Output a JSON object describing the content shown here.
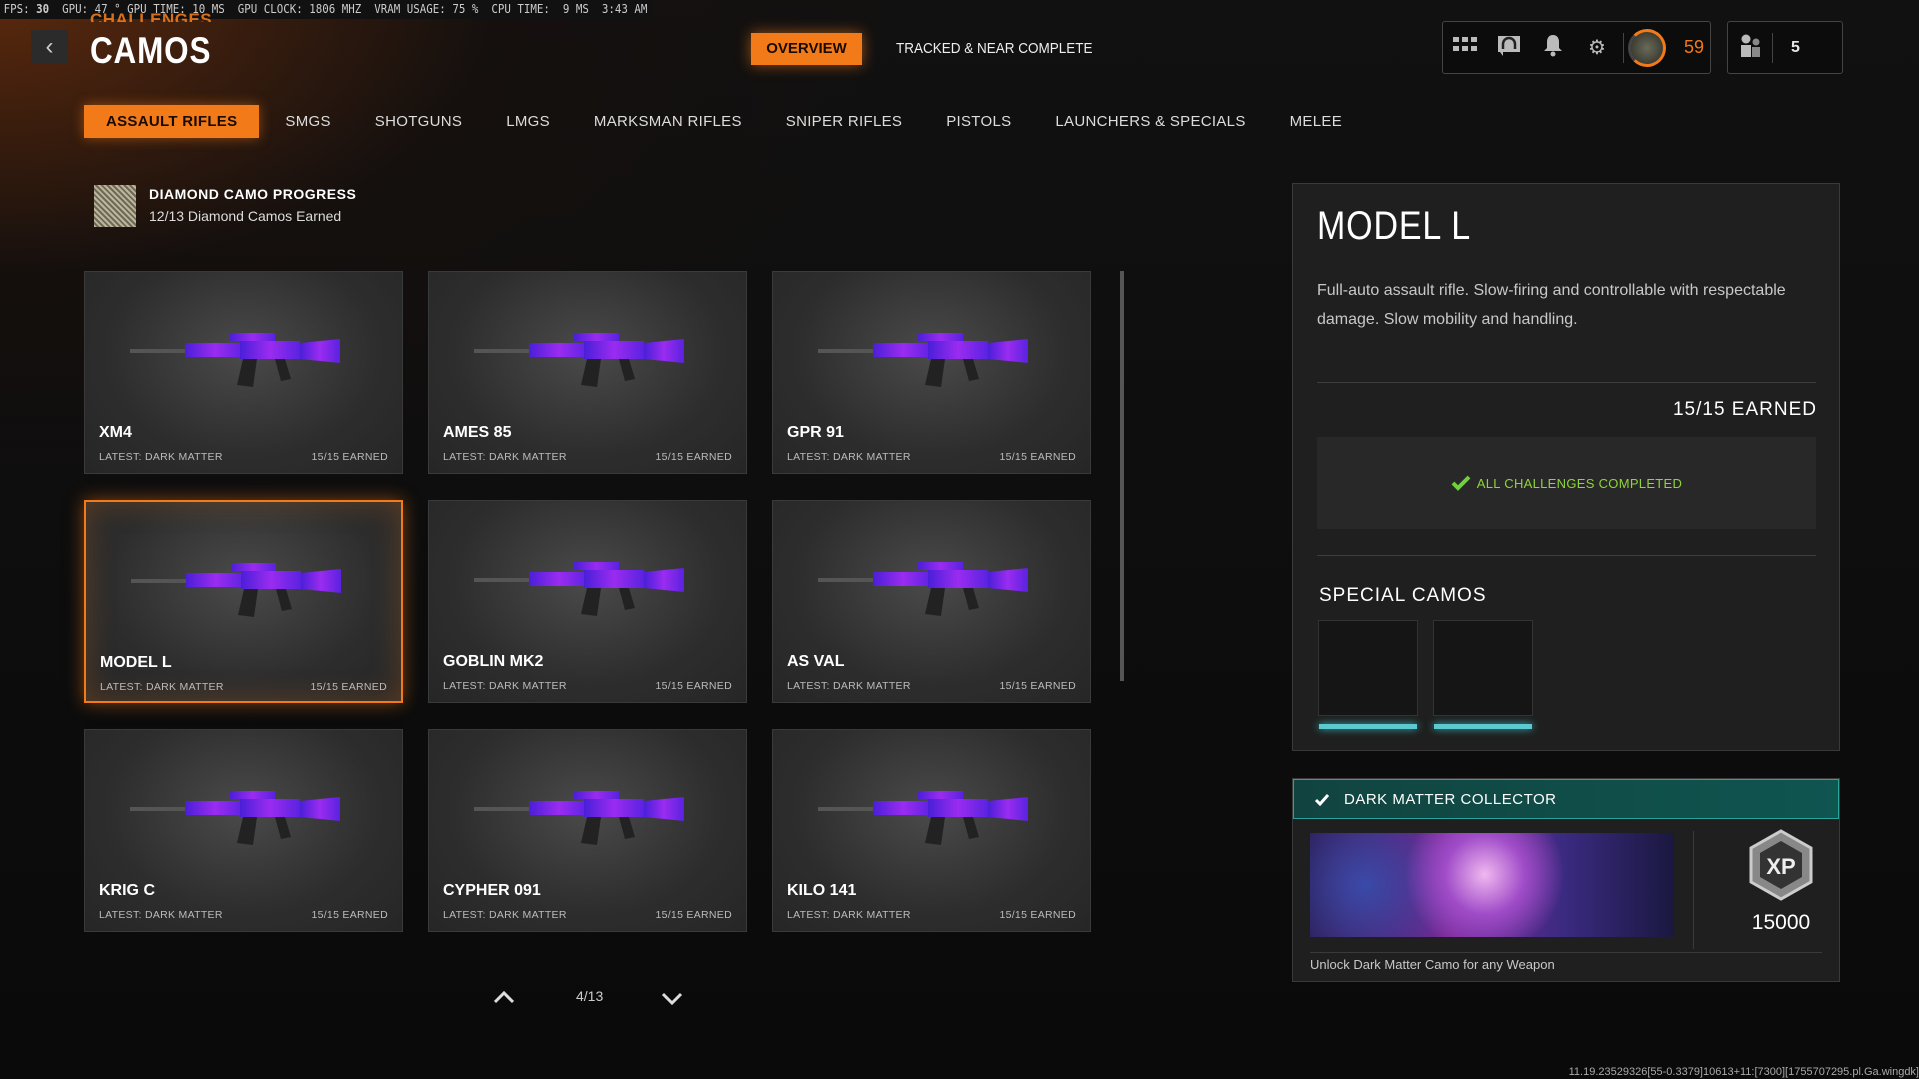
{
  "perf": {
    "fps_label": "FPS:",
    "fps": "30",
    "gpu": "GPU: 47 °",
    "gpu_time": "GPU TIME: 10 MS",
    "gpu_clock": "GPU CLOCK: 1806 MHZ",
    "vram": "VRAM USAGE: 75 %",
    "cpu_time": "CPU TIME:  9 MS",
    "clock": "3:43 AM"
  },
  "header": {
    "breadcrumb": "CHALLENGES",
    "title": "CAMOS",
    "overview": "OVERVIEW",
    "tracked": "TRACKED & NEAR COMPLETE",
    "level": "59",
    "party_count": "5"
  },
  "tabs": [
    "ASSAULT RIFLES",
    "SMGS",
    "SHOTGUNS",
    "LMGS",
    "MARKSMAN RIFLES",
    "SNIPER RIFLES",
    "PISTOLS",
    "LAUNCHERS & SPECIALS",
    "MELEE"
  ],
  "diamond": {
    "title": "DIAMOND CAMO PROGRESS",
    "subtitle": "12/13 Diamond Camos Earned"
  },
  "weapons": [
    {
      "name": "XM4",
      "latest": "LATEST: DARK MATTER",
      "earned": "15/15 EARNED"
    },
    {
      "name": "AMES 85",
      "latest": "LATEST: DARK MATTER",
      "earned": "15/15 EARNED"
    },
    {
      "name": "GPR 91",
      "latest": "LATEST: DARK MATTER",
      "earned": "15/15 EARNED"
    },
    {
      "name": "MODEL L",
      "latest": "LATEST: DARK MATTER",
      "earned": "15/15 EARNED"
    },
    {
      "name": "GOBLIN MK2",
      "latest": "LATEST: DARK MATTER",
      "earned": "15/15 EARNED"
    },
    {
      "name": "AS VAL",
      "latest": "LATEST: DARK MATTER",
      "earned": "15/15 EARNED"
    },
    {
      "name": "KRIG C",
      "latest": "LATEST: DARK MATTER",
      "earned": "15/15 EARNED"
    },
    {
      "name": "CYPHER 091",
      "latest": "LATEST: DARK MATTER",
      "earned": "15/15 EARNED"
    },
    {
      "name": "KILO 141",
      "latest": "LATEST: DARK MATTER",
      "earned": "15/15 EARNED"
    }
  ],
  "pagination": "4/13",
  "detail": {
    "title": "MODEL L",
    "description": "Full-auto assault rifle.  Slow-firing and controllable with respectable damage. Slow mobility and handling.",
    "earned": "15/15 EARNED",
    "completed": "ALL CHALLENGES COMPLETED",
    "special_camos": "SPECIAL CAMOS"
  },
  "reward": {
    "title": "DARK MATTER COLLECTOR",
    "xp": "15000",
    "xp_badge": "XP",
    "description": "Unlock Dark Matter Camo for any Weapon"
  },
  "footer": "11.19.23529326[55-0.3379]10613+11:[7300][1755707295.pl.Ga.wingdk]"
}
